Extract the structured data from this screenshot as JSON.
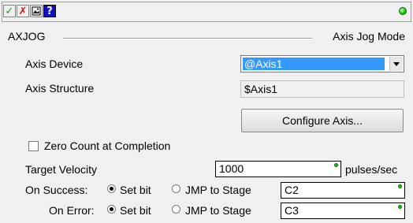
{
  "toolbar": {
    "icons": [
      "check-icon",
      "x-icon",
      "picture-icon",
      "help-icon"
    ],
    "check_glyph": "✓",
    "x_glyph": "✗",
    "help_glyph": "?",
    "status_led_color": "#19c40f"
  },
  "header": {
    "instruction": "AXJOG",
    "title": "Axis Jog Mode"
  },
  "axis_device": {
    "label": "Axis Device",
    "value": "@Axis1"
  },
  "axis_structure": {
    "label": "Axis Structure",
    "value": "$Axis1"
  },
  "configure_button": {
    "label": "Configure Axis..."
  },
  "zero_count": {
    "label": "Zero Count at Completion",
    "checked": false
  },
  "target_velocity": {
    "label": "Target Velocity",
    "value": "1000",
    "units": "pulses/sec"
  },
  "on_success": {
    "label": "On Success:",
    "option_set_bit": "Set bit",
    "option_jmp": "JMP to Stage",
    "selected": "Set bit",
    "value": "C2"
  },
  "on_error": {
    "label": "On Error:",
    "option_set_bit": "Set bit",
    "option_jmp": "JMP to Stage",
    "selected": "Set bit",
    "value": "C3"
  },
  "colors": {
    "selection": "#3399ff",
    "status_green": "#19c40f",
    "cancel_red": "#e01010",
    "help_blue": "#1010c0"
  }
}
